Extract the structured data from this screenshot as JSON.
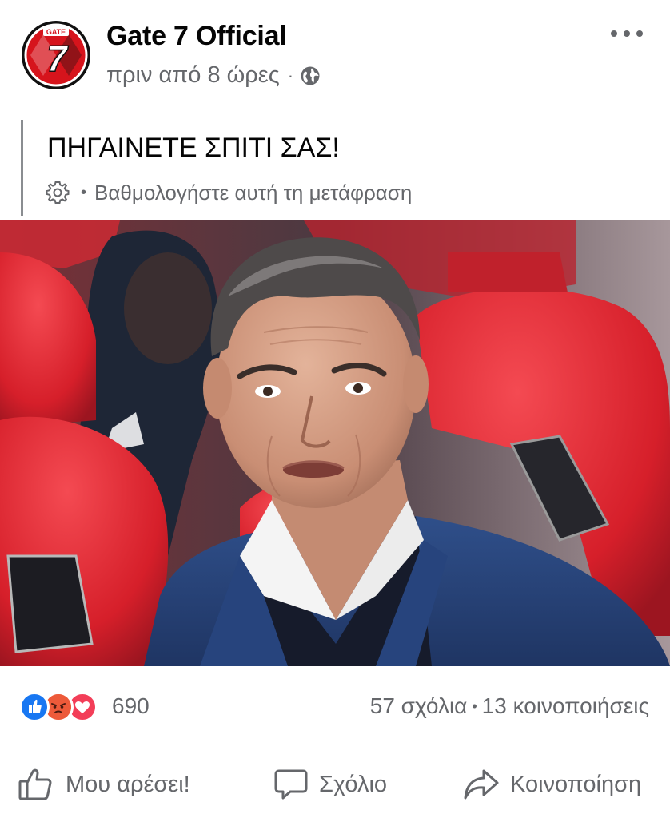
{
  "post": {
    "page_name": "Gate 7 Official",
    "time_ago": "πριν από 8 ώρες",
    "privacy_icon": "globe-icon",
    "text": "ΠΗΓΑΙΝΕΤΕ ΣΠΙΤΙ ΣΑΣ!",
    "translation_rate": "Βαθμολογήστε αυτή τη μετάφραση",
    "avatar_number": "7",
    "avatar_text": "GATE"
  },
  "reactions": {
    "types": [
      "like",
      "angry",
      "love"
    ],
    "count": "690"
  },
  "engagement": {
    "comments": "57 σχόλια",
    "shares": "13 κοινοποιήσεις"
  },
  "actions": {
    "like_label": "Μου αρέσει!",
    "comment_label": "Σχόλιο",
    "share_label": "Κοινοποίηση"
  },
  "colors": {
    "like_blue": "#1877f2",
    "angry_orange": "#f7714c",
    "love_red": "#f33e58",
    "text_secondary": "#65676b"
  }
}
